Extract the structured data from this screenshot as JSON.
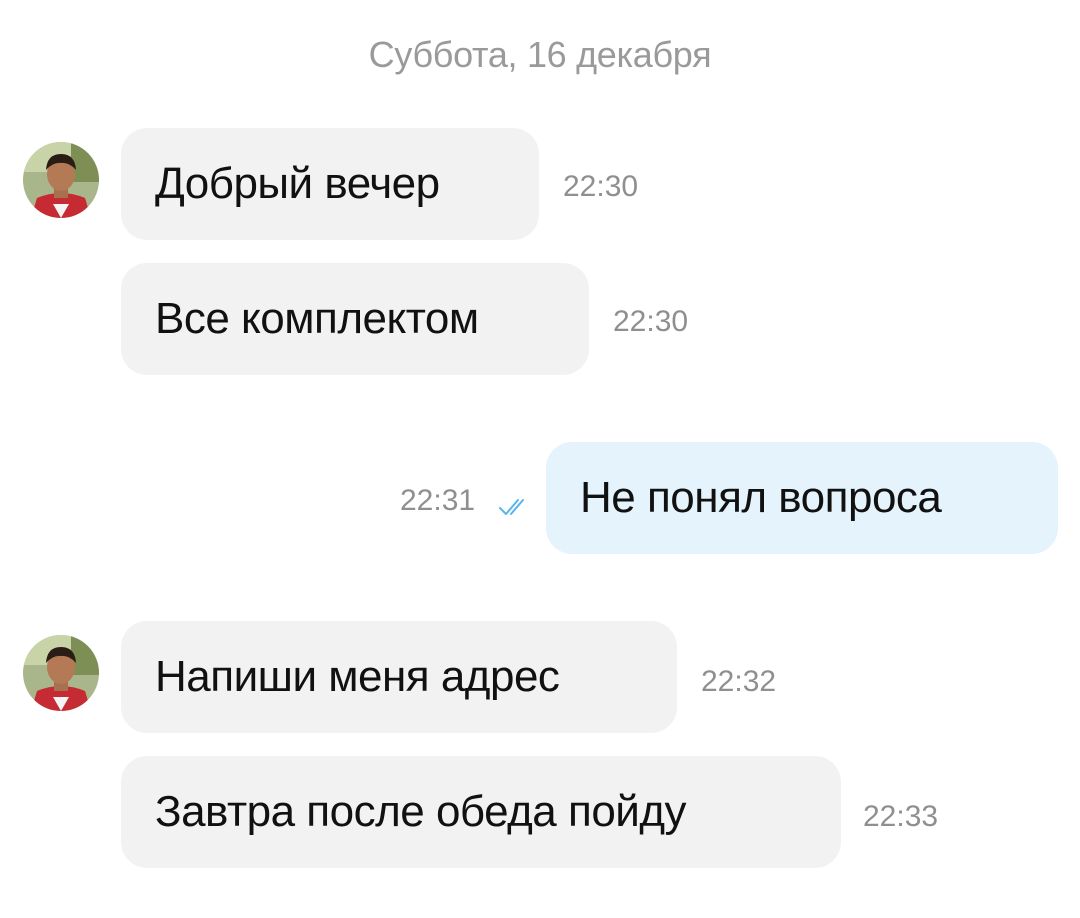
{
  "date_header": "Суббота, 16 декабря",
  "messages": [
    {
      "text": "Добрый вечер",
      "time": "22:30",
      "direction": "incoming"
    },
    {
      "text": "Все комплектом",
      "time": "22:30",
      "direction": "incoming"
    },
    {
      "text": "Не понял вопроса",
      "time": "22:31",
      "direction": "outgoing",
      "status_icon": "double-check-icon"
    },
    {
      "text": "Напиши меня адрес",
      "time": "22:32",
      "direction": "incoming"
    },
    {
      "text": "Завтра после обеда пойду",
      "time": "22:33",
      "direction": "incoming"
    }
  ],
  "colors": {
    "incoming_bubble": "#f2f2f3",
    "outgoing_bubble": "#e5f3fd",
    "timestamp": "#8f8f8f",
    "read_check": "#5ab4ee"
  }
}
